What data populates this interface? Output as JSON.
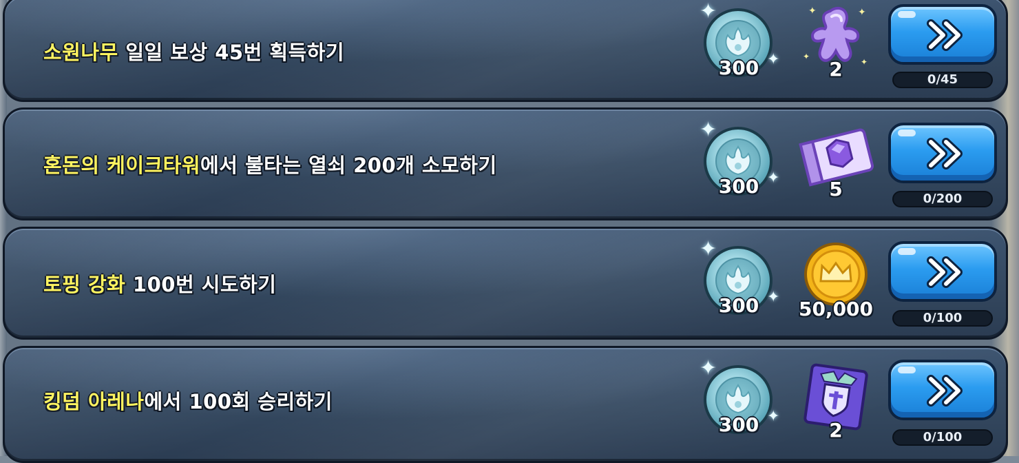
{
  "missions": [
    {
      "title_highlight": "소원나무",
      "title_rest": " 일일 보상 45번 획득하기",
      "reward_coin": "300",
      "reward_item_icon": "purple-ginger-cookie-icon",
      "reward_item_count": "2",
      "progress_label": "0/45",
      "progress_value": 0,
      "progress_max": 45
    },
    {
      "title_highlight": "혼돈의 케이크타워",
      "title_rest": "에서 불타는 열쇠 200개 소모하기",
      "reward_coin": "300",
      "reward_item_icon": "purple-gem-ticket-icon",
      "reward_item_count": "5",
      "progress_label": "0/200",
      "progress_value": 0,
      "progress_max": 200
    },
    {
      "title_highlight": "토핑 강화",
      "title_rest": " 100번 시도하기",
      "reward_coin": "300",
      "reward_item_icon": "gold-crown-coin-icon",
      "reward_item_count": "50,000",
      "progress_label": "0/100",
      "progress_value": 0,
      "progress_max": 100
    },
    {
      "title_highlight": "킹덤 아레나",
      "title_rest": "에서 100회 승리하기",
      "reward_coin": "300",
      "reward_item_icon": "arena-shield-box-icon",
      "reward_item_count": "2",
      "progress_label": "0/100",
      "progress_value": 0,
      "progress_max": 100
    }
  ],
  "colors": {
    "highlight_text": "#fff45a",
    "button_blue": "#2b9cf0",
    "panel": "#34485f"
  }
}
